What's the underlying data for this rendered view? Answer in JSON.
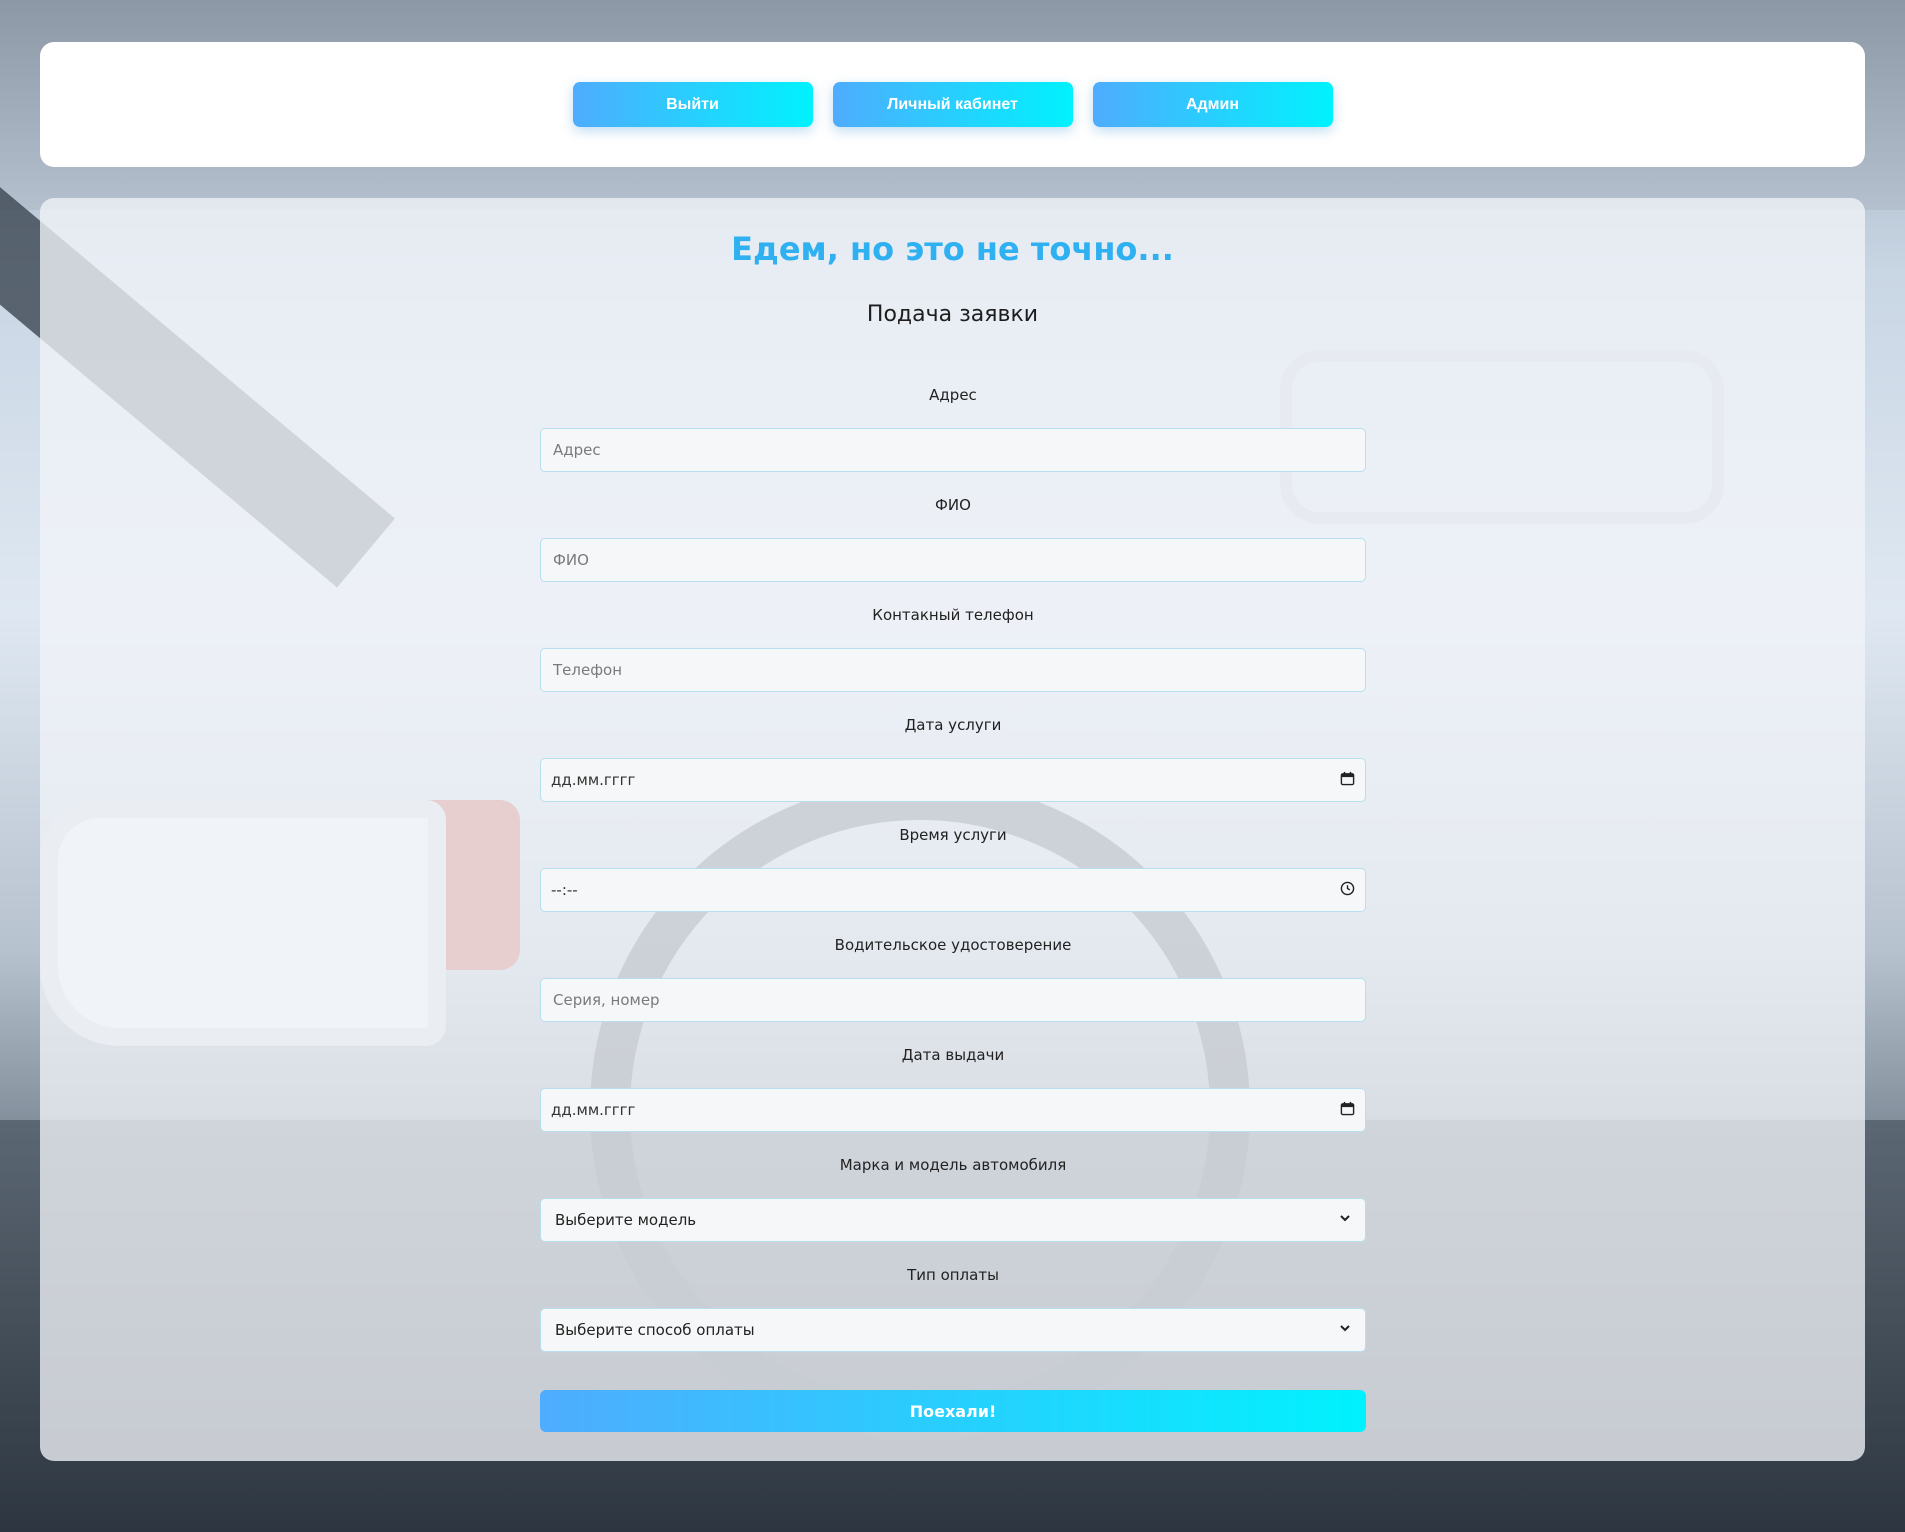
{
  "nav": {
    "logout": "Выйти",
    "cabinet": "Личный кабинет",
    "admin": "Админ"
  },
  "header": {
    "title": "Едем, но это не точно...",
    "subtitle": "Подача заявки"
  },
  "form": {
    "address": {
      "label": "Адрес",
      "placeholder": "Адрес"
    },
    "fullname": {
      "label": "ФИО",
      "placeholder": "ФИО"
    },
    "phone": {
      "label": "Контакный телефон",
      "placeholder": "Телефон"
    },
    "service_date": {
      "label": "Дата услуги",
      "value": "дд.мм.гггг"
    },
    "service_time": {
      "label": "Время услуги",
      "value": "--:--"
    },
    "license": {
      "label": "Водительское удостоверение",
      "placeholder": "Серия, номер"
    },
    "issue_date": {
      "label": "Дата выдачи",
      "value": "дд.мм.гггг"
    },
    "car_model": {
      "label": "Марка и модель автомобиля",
      "selected": "Выберите модель"
    },
    "payment": {
      "label": "Тип оплаты",
      "selected": "Выберите способ оплаты"
    },
    "submit": "Поехали!"
  },
  "icons": {
    "calendar": "calendar-icon",
    "clock": "clock-icon",
    "chevron": "chevron-down-icon"
  },
  "colors": {
    "accent_start": "#4facfe",
    "accent_end": "#00f2fe",
    "title": "#2fb0f0"
  }
}
